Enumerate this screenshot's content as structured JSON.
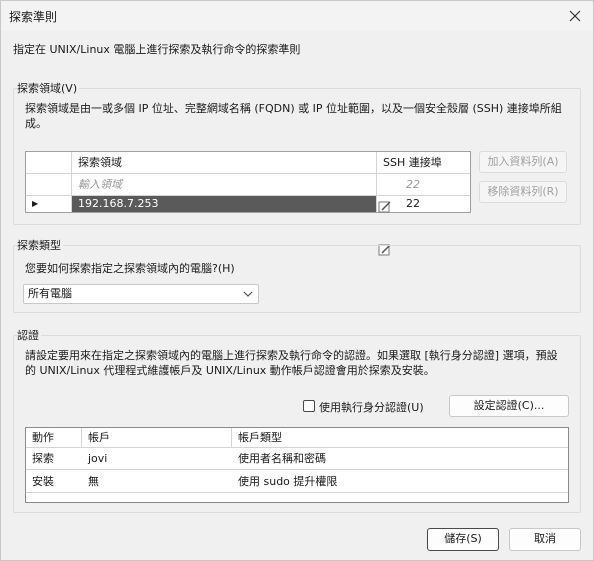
{
  "window": {
    "title": "探索準則"
  },
  "description": "指定在 UNIX/Linux 電腦上進行探索及執行命令的探索準則",
  "scope_group": {
    "label": "探索領域(V)",
    "text": "探索領域是由一或多個 IP 位址、完整網域名稱 (FQDN) 或 IP 位址範圍，以及一個安全殼層 (SSH) 連接埠所組成。",
    "columns": {
      "scope": "探索領域",
      "port": "SSH 連接埠"
    },
    "new_row": {
      "scope_placeholder": "輸入領域",
      "port_placeholder": "22"
    },
    "rows": [
      {
        "scope": "192.168.7.253",
        "port": "22"
      }
    ],
    "add_button": "加入資料列(A)",
    "remove_button": "移除資料列(R)"
  },
  "type_group": {
    "label": "探索類型",
    "question": "您要如何探索指定之探索領域內的電腦?(H)",
    "selected": "所有電腦"
  },
  "auth_group": {
    "label": "認證",
    "text": "請設定要用來在指定之探索領域內的電腦上進行探索及執行命令的認證。如果選取 [執行身分認證] 選項，預設的 UNIX/Linux 代理程式維護帳戶及 UNIX/Linux 動作帳戶認證會用於探索及安裝。",
    "runas_checkbox": "使用執行身分認證(U)",
    "runas_checked": false,
    "set_credentials_button": "設定認證(C)...",
    "columns": {
      "action": "動作",
      "account": "帳戶",
      "account_type": "帳戶類型"
    },
    "rows": [
      {
        "action": "探索",
        "account": "jovi",
        "account_type": "使用者名稱和密碼"
      },
      {
        "action": "安裝",
        "account": "無",
        "account_type": "使用 sudo 提升權限"
      }
    ]
  },
  "footer": {
    "save_button": "儲存(S)",
    "cancel_button": "取消"
  }
}
